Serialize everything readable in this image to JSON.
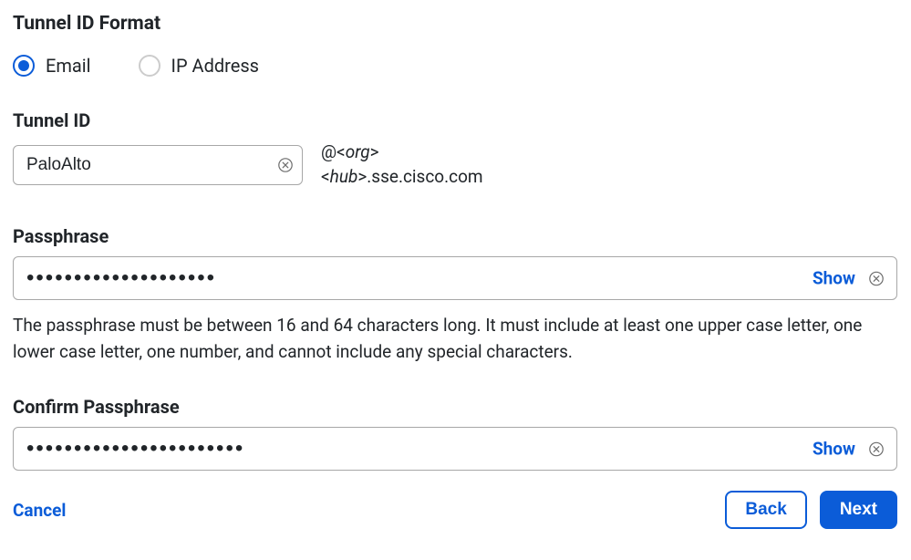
{
  "section": {
    "title": "Tunnel ID Format"
  },
  "radio": {
    "email_label": "Email",
    "ip_label": "IP Address",
    "selected": "email"
  },
  "tunnel_id": {
    "label": "Tunnel ID",
    "value": "PaloAlto",
    "suffix_line1_prefix": "@<",
    "suffix_line1_em": "org",
    "suffix_line1_suffix": ">",
    "suffix_line2_prefix": "<",
    "suffix_line2_em": "hub",
    "suffix_line2_suffix": ">.sse.cisco.com"
  },
  "passphrase": {
    "label": "Passphrase",
    "masked_value": "••••••••••••••••••••",
    "show_label": "Show",
    "help_text": "The passphrase must be between 16 and 64 characters long. It must include at least one upper case letter, one lower case letter, one number, and cannot include any special characters."
  },
  "confirm_passphrase": {
    "label": "Confirm Passphrase",
    "masked_value": "•••••••••••••••••••••••",
    "show_label": "Show"
  },
  "footer": {
    "cancel_label": "Cancel",
    "back_label": "Back",
    "next_label": "Next"
  }
}
